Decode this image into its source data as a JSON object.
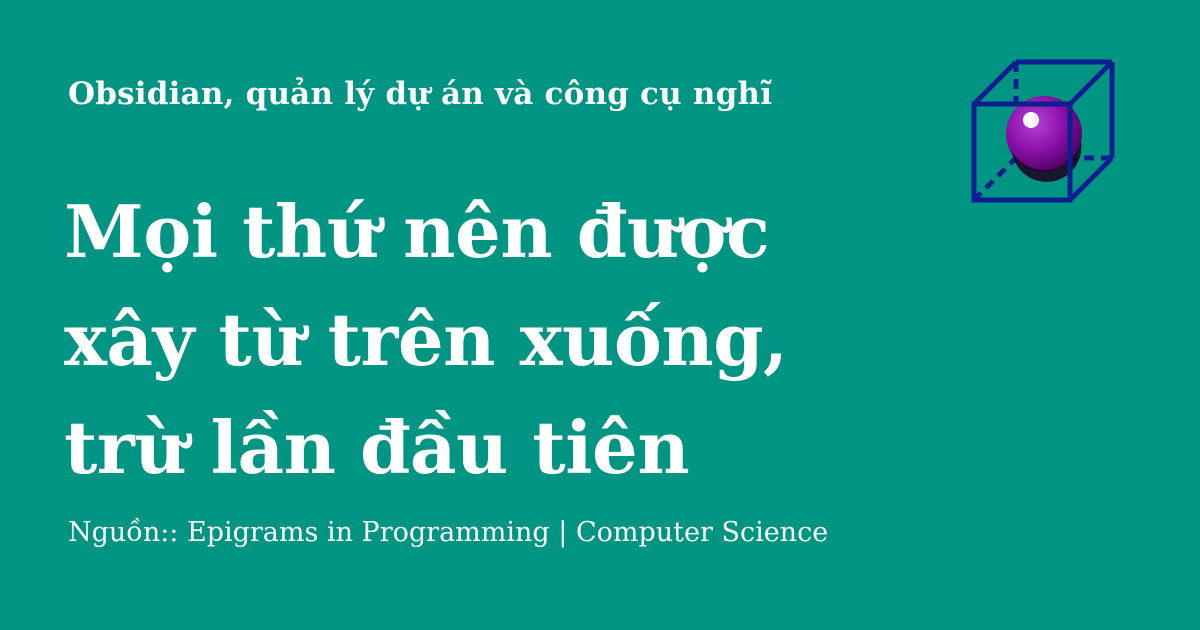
{
  "header": {
    "subtitle": "Obsidian, quản lý dự án và công cụ nghĩ"
  },
  "headline": {
    "lines": [
      "Mọi thứ nên được",
      "xây từ trên xuống,",
      "trừ lần đầu tiên"
    ]
  },
  "footer": {
    "source": "Nguồn:: Epigrams in Programming | Computer Science"
  },
  "logo": {
    "icon": "cube-with-sphere-icon",
    "colors": {
      "cube": "#0d1f8f",
      "sphere": "#8a0fa8",
      "sphere_shadow": "#3a0045",
      "highlight": "#ffffff"
    }
  },
  "theme": {
    "background": "#009483",
    "text": "#ffffff"
  }
}
